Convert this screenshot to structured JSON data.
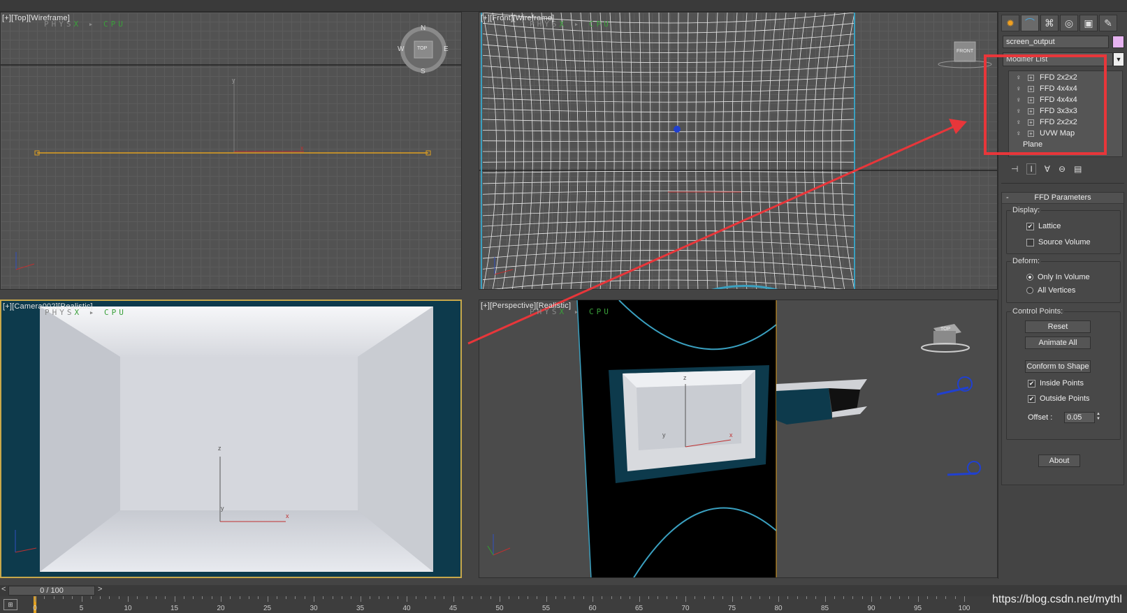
{
  "viewports": {
    "top": {
      "label": "[+][Top][Wireframe]",
      "physx": [
        "PHYS",
        "X",
        "CPU"
      ],
      "compass": {
        "n": "N",
        "s": "S",
        "e": "E",
        "w": "W",
        "cube": "TOP"
      }
    },
    "front": {
      "label": "[+][Front][Wireframe]",
      "physx": [
        "PHYS",
        "X",
        "CPU"
      ],
      "cube": "FRONT"
    },
    "camera": {
      "label": "[+][Camera002][Realistic]",
      "physx": [
        "PHYS",
        "X",
        "CPU"
      ]
    },
    "perspective": {
      "label": "[+][Perspective][Realistic]",
      "physx": [
        "PHYS",
        "X",
        "CPU"
      ],
      "cube": "TOP"
    }
  },
  "axis": {
    "x": "x",
    "y": "y",
    "z": "z"
  },
  "panel": {
    "tabs": [
      {
        "icon": "sun-icon",
        "glyph": "✹"
      },
      {
        "icon": "curve-icon",
        "glyph": "⌒"
      },
      {
        "icon": "hierarchy-icon",
        "glyph": "⌘"
      },
      {
        "icon": "motion-icon",
        "glyph": "◎"
      },
      {
        "icon": "display-icon",
        "glyph": "▣"
      },
      {
        "icon": "hammer-icon",
        "glyph": "✎"
      }
    ],
    "object_name": "screen_output",
    "object_color": "#e6b3f0",
    "modifier_list": "Modifier List",
    "stack": [
      "FFD 2x2x2",
      "FFD 4x4x4",
      "FFD 4x4x4",
      "FFD 3x3x3",
      "FFD 2x2x2",
      "UVW Map"
    ],
    "stack_base": "Plane",
    "rollout": {
      "title": "FFD Parameters",
      "collapse": "-",
      "display_group": "Display:",
      "lattice": "Lattice",
      "source_volume": "Source Volume",
      "deform_group": "Deform:",
      "only_in_volume": "Only In Volume",
      "all_vertices": "All Vertices",
      "control_group": "Control Points:",
      "reset": "Reset",
      "animate_all": "Animate All",
      "conform": "Conform to Shape",
      "inside_points": "Inside Points",
      "outside_points": "Outside Points",
      "offset_label": "Offset :",
      "offset_value": "0.05",
      "about": "About"
    }
  },
  "timeline": {
    "frame": "0 / 100",
    "prev": "<",
    "next": ">",
    "ticks": [
      "0",
      "5",
      "10",
      "15",
      "20",
      "25",
      "30",
      "35",
      "40",
      "45",
      "50",
      "55",
      "60",
      "65",
      "70",
      "75",
      "80",
      "85",
      "90",
      "95",
      "100"
    ]
  },
  "watermark": "https://blog.csdn.net/mythl",
  "colors": {
    "annotation": "#e8363a",
    "active_border": "#c8a84a",
    "selection": "#e0a020"
  }
}
